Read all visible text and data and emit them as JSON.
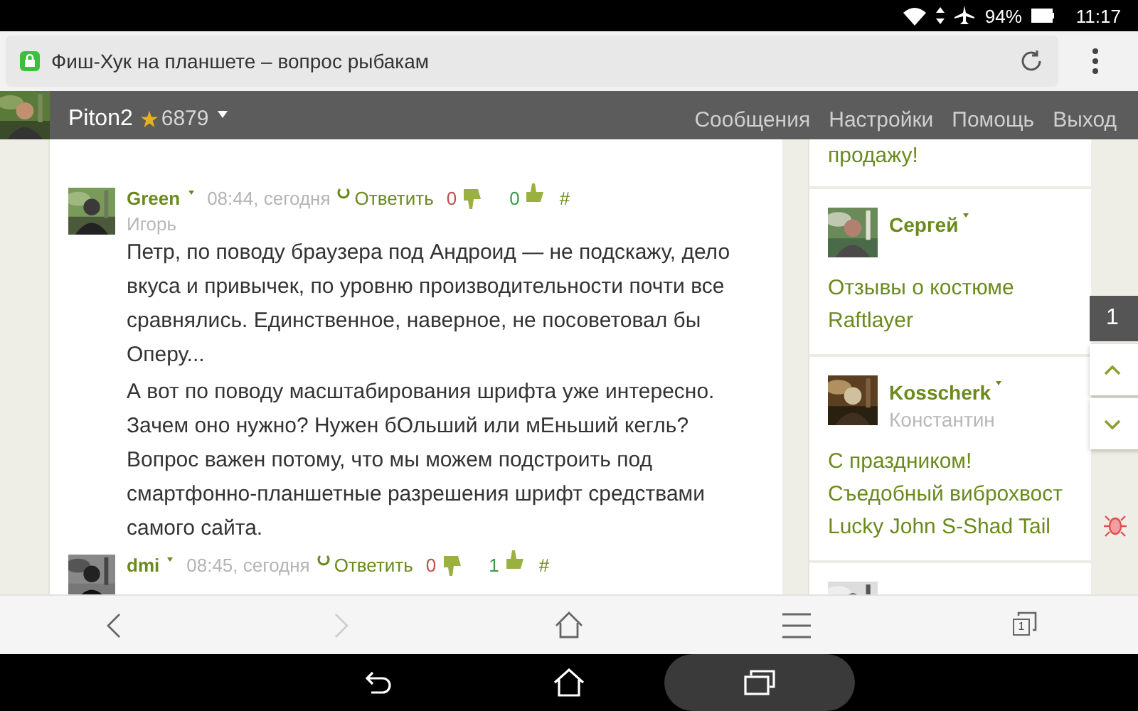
{
  "status_bar": {
    "battery": "94%",
    "time": "11:17"
  },
  "browser": {
    "title": "Фиш-Хук на планшете – вопрос рыбакам"
  },
  "user_bar": {
    "username": "Piton2",
    "rating": "6879",
    "links": [
      "Сообщения",
      "Настройки",
      "Помощь",
      "Выход"
    ]
  },
  "comments": [
    {
      "author": "Green",
      "time": "08:44, сегодня",
      "reply": "Ответить",
      "minus": "0",
      "plus": "0",
      "anchor": "#",
      "real_name": "Игорь",
      "paragraphs": [
        "Петр, по поводу браузера под Андроид — не подскажу, дело вкуса и привычек, по уровню производительности почти все сравнялись. Единственное, наверное, не посоветовал бы Оперу...",
        "А вот по поводу масштабирования шрифта уже интересно. Зачем оно нужно? Нужен бОльший или мЕньший кегль? Вопрос важен потому, что мы можем подстроить под смартфонно-планшетные разрешения шрифт средствами самого сайта."
      ]
    },
    {
      "author": "dmi",
      "time": "08:45, сегодня",
      "reply": "Ответить",
      "minus": "0",
      "plus": "1",
      "anchor": "#"
    }
  ],
  "sidebar": {
    "items": [
      {
        "kind": "tail",
        "lines": [
          "продажу!"
        ]
      },
      {
        "kind": "entry",
        "author": "Сергей",
        "lines": [
          "Отзывы о костюме",
          "Raftlayer"
        ]
      },
      {
        "kind": "entry",
        "author": "Kosscherk",
        "real_name": "Константин",
        "lines": [
          "С праздником!",
          "Съедобный виброхвост",
          "Lucky John S-Shad Tail"
        ]
      },
      {
        "kind": "picture"
      }
    ]
  },
  "scroll_widget": {
    "count": "1"
  },
  "toolbar": {
    "tab_count": "1",
    "forward_disabled": true
  },
  "nav_buttons": [
    {
      "kind": "back",
      "selected": false
    },
    {
      "kind": "home",
      "selected": false
    },
    {
      "kind": "recents",
      "selected": true
    }
  ]
}
